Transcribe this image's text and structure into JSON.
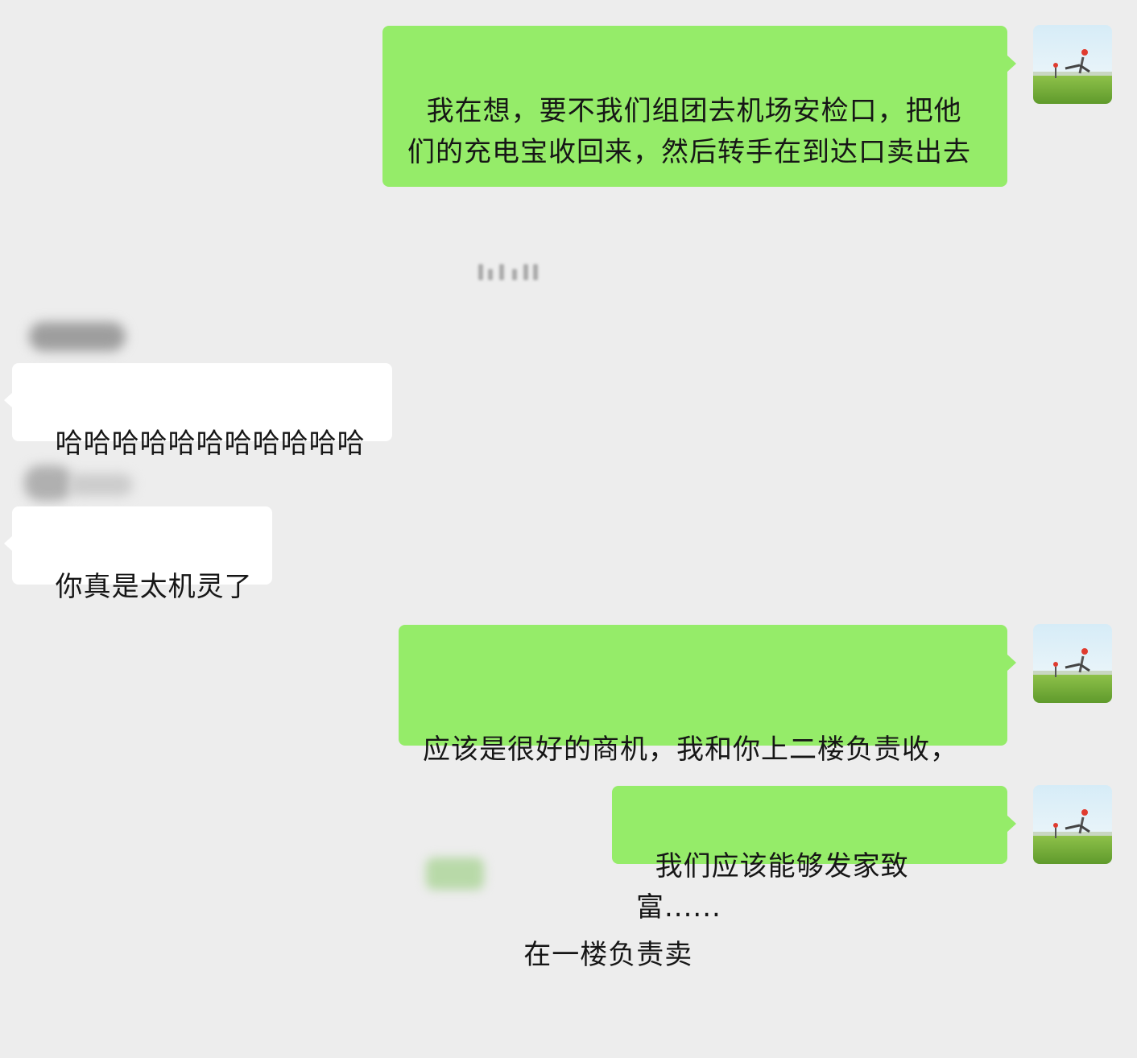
{
  "messages": [
    {
      "sender": "me",
      "text": "我在想，要不我们组团去机场安检口，把他们的充电宝收回来，然后转手在到达口卖出去"
    },
    {
      "sender": "other",
      "text": "哈哈哈哈哈哈哈哈哈哈哈"
    },
    {
      "sender": "other",
      "text": "你真是太机灵了"
    },
    {
      "sender": "me",
      "text_line1": "应该是很好的商机，我和你上二楼负责收，",
      "text_line2_visible": "在一楼负责卖"
    },
    {
      "sender": "me",
      "text": "我们应该能够发家致富......"
    }
  ],
  "icons": {
    "avatar": "avatar-landscape-icon"
  },
  "colors": {
    "background": "#ededed",
    "my_bubble": "#95ec69",
    "other_bubble": "#ffffff",
    "text": "#161616"
  }
}
